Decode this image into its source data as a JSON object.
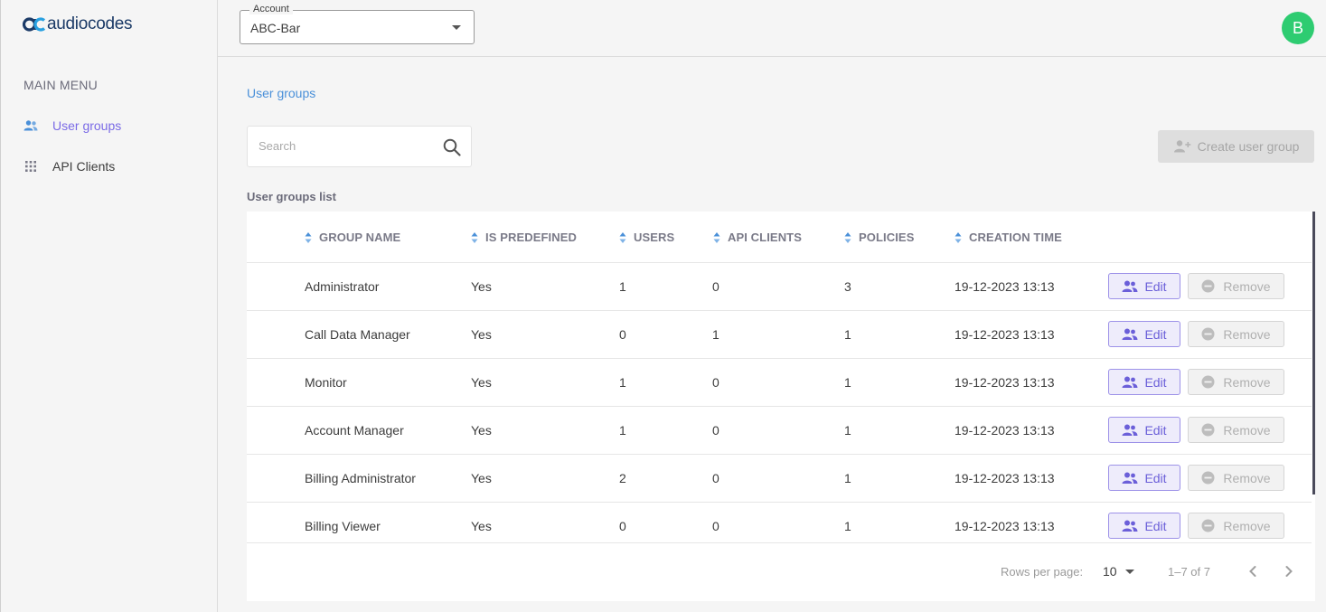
{
  "app": {
    "logo_text": "audiocodes"
  },
  "sidebar": {
    "section_title": "MAIN MENU",
    "items": [
      {
        "label": "User groups",
        "icon": "users-icon",
        "active": true
      },
      {
        "label": "API Clients",
        "icon": "grid-icon",
        "active": false
      }
    ]
  },
  "header": {
    "account": {
      "label": "Account",
      "value": "ABC-Bar"
    },
    "avatar_initial": "B",
    "avatar_color": "#2ecc71"
  },
  "breadcrumb": "User groups",
  "search": {
    "placeholder": "Search",
    "value": ""
  },
  "create_button": {
    "label": "Create user group",
    "disabled": true
  },
  "list_title": "User groups list",
  "table": {
    "columns": [
      "GROUP NAME",
      "IS PREDEFINED",
      "USERS",
      "API CLIENTS",
      "POLICIES",
      "CREATION TIME"
    ],
    "rows": [
      {
        "name": "Administrator",
        "predefined": "Yes",
        "users": "1",
        "api_clients": "0",
        "policies": "3",
        "created": "19-12-2023 13:13"
      },
      {
        "name": "Call Data Manager",
        "predefined": "Yes",
        "users": "0",
        "api_clients": "1",
        "policies": "1",
        "created": "19-12-2023 13:13"
      },
      {
        "name": "Monitor",
        "predefined": "Yes",
        "users": "1",
        "api_clients": "0",
        "policies": "1",
        "created": "19-12-2023 13:13"
      },
      {
        "name": "Account Manager",
        "predefined": "Yes",
        "users": "1",
        "api_clients": "0",
        "policies": "1",
        "created": "19-12-2023 13:13"
      },
      {
        "name": "Billing Administrator",
        "predefined": "Yes",
        "users": "2",
        "api_clients": "0",
        "policies": "1",
        "created": "19-12-2023 13:13"
      },
      {
        "name": "Billing Viewer",
        "predefined": "Yes",
        "users": "0",
        "api_clients": "0",
        "policies": "1",
        "created": "19-12-2023 13:13"
      }
    ],
    "edit_label": "Edit",
    "remove_label": "Remove"
  },
  "pagination": {
    "rows_per_page_label": "Rows per page:",
    "rows_per_page": "10",
    "range": "1–7 of 7"
  },
  "colors": {
    "accent": "#7a6ae6",
    "link": "#4a90d9",
    "brand": "#1b3a67"
  }
}
